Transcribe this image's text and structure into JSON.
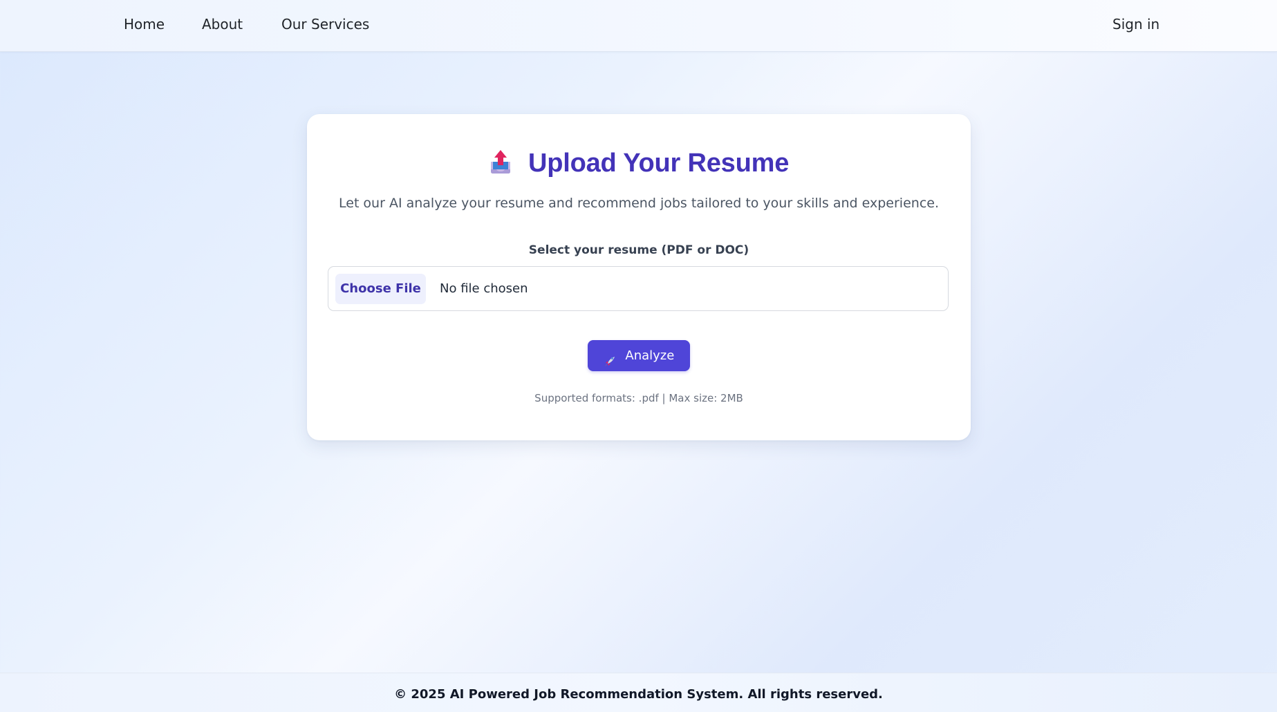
{
  "nav": {
    "links": [
      {
        "label": "Home"
      },
      {
        "label": "About"
      },
      {
        "label": "Our Services"
      }
    ],
    "signin_label": "Sign in"
  },
  "upload_card": {
    "title_icon": "outbox-tray-icon",
    "title": "Upload Your Resume",
    "subtitle": "Let our AI analyze your resume and recommend jobs tailored to your skills and experience.",
    "file_label": "Select your resume (PDF or DOC)",
    "choose_file_label": "Choose File",
    "file_status": "No file chosen",
    "analyze_icon": "rocket-icon",
    "analyze_label": "Analyze",
    "formats_note": "Supported formats: .pdf | Max size: 2MB"
  },
  "footer": {
    "text": "© 2025 AI Powered Job Recommendation System. All rights reserved."
  },
  "colors": {
    "accent": "#4f45d8",
    "title": "#4333b8",
    "choose_button_bg": "#eef0fd"
  }
}
